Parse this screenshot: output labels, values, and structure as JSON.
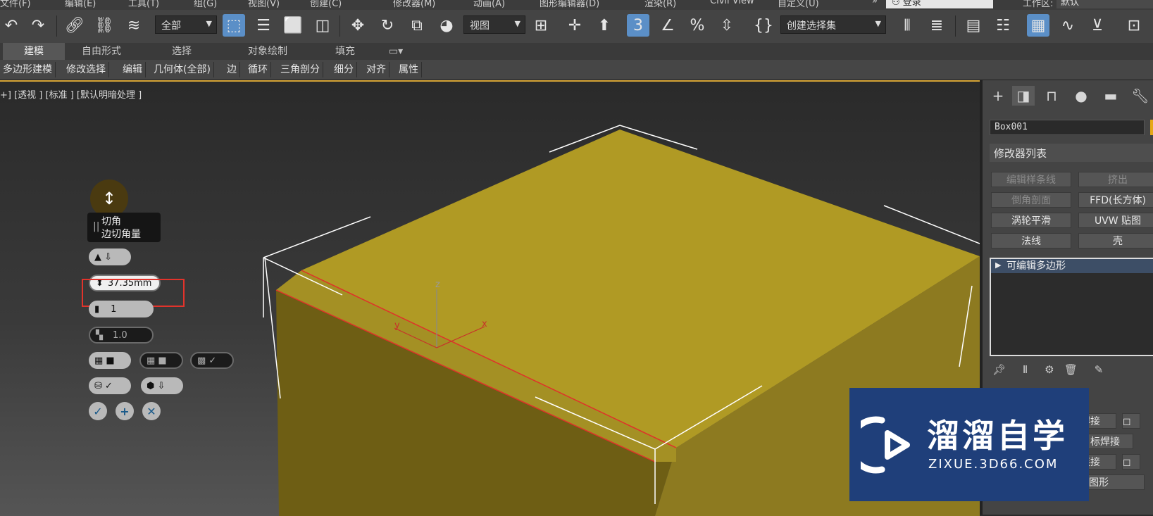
{
  "menu": {
    "items": [
      "文件(F)",
      "编辑(E)",
      "工具(T)",
      "组(G)",
      "视图(V)",
      "创建(C)",
      "修改器(M)",
      "动画(A)",
      "图形编辑器(D)",
      "渲染(R)",
      "Civil View",
      "自定义(U)"
    ],
    "login_label": "登录",
    "workspace_label": "工作区:",
    "workspace_value": "默认"
  },
  "toolbar": {
    "selection_filter": "全部",
    "reference_coord": "视图",
    "named_selection": "创建选择集",
    "snap_label": "3"
  },
  "ribbon": {
    "tabs": [
      "建模",
      "自由形式",
      "选择",
      "对象绘制",
      "填充"
    ],
    "active_tab": "建模",
    "panel_buttons": [
      "多边形建模",
      "修改选择",
      "编辑",
      "几何体(全部)",
      "边",
      "循环",
      "三角剖分",
      "细分",
      "对齐",
      "属性"
    ]
  },
  "viewport": {
    "label": "+] [透视 ] [标准 ] [默认明暗处理 ]",
    "axis_x": "x",
    "axis_y": "y",
    "axis_z": "z"
  },
  "caddy": {
    "tooltip_title": "切角",
    "tooltip_subtitle": "边切角量",
    "amount_value": "37.35mm",
    "segments_value": "1",
    "tension_value": "1.0"
  },
  "command_panel": {
    "object_name": "Box001",
    "object_color": "#e6a817",
    "modifier_list_label": "修改器列表",
    "modifier_buttons": [
      {
        "label": "编辑样条线",
        "enabled": false
      },
      {
        "label": "挤出",
        "enabled": false
      },
      {
        "label": "倒角剖面",
        "enabled": false
      },
      {
        "label": "FFD(长方体)",
        "enabled": true
      },
      {
        "label": "涡轮平滑",
        "enabled": true
      },
      {
        "label": "UVW 贴图",
        "enabled": true
      },
      {
        "label": "法线",
        "enabled": true
      },
      {
        "label": "壳",
        "enabled": true
      }
    ],
    "stack_item": "可编辑多边形",
    "lower_buttons": [
      "焊接",
      "目标焊接",
      "连接",
      "利用所选内容创建图形"
    ]
  },
  "watermark": {
    "title": "溜溜自学",
    "url": "ZIXUE.3D66.COM"
  }
}
